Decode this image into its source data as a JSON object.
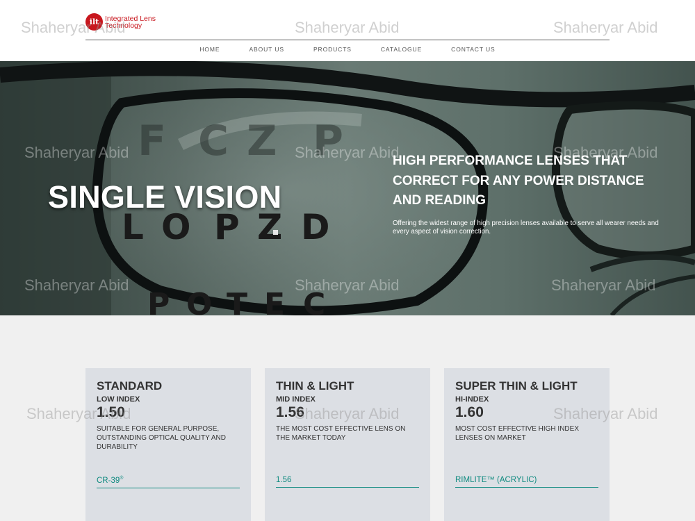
{
  "brand": {
    "logo_mark": "ilt",
    "line1": "Integrated Lens",
    "line2": "Technology",
    "color": "#c8171e"
  },
  "nav": [
    "HOME",
    "ABOUT US",
    "PRODUCTS",
    "CATALOGUE",
    "CONTACT US"
  ],
  "hero": {
    "title": "SINGLE VISION",
    "heading": "HIGH PERFORMANCE LENSES THAT CORRECT FOR ANY POWER DISTANCE AND READING",
    "text": "Offering the widest range of high precision lenses available to serve all wearer needs and every aspect of vision correction.",
    "eye_chart": {
      "row1": [
        "F",
        "C",
        "Z",
        "P"
      ],
      "row2": [
        "L",
        "O",
        "P",
        "Z",
        "D"
      ],
      "row3": [
        "P",
        "O",
        "T",
        "E",
        "C"
      ]
    }
  },
  "cards": [
    {
      "title": "STANDARD",
      "sub": "LOW INDEX",
      "index": "1.50",
      "desc": "SUITABLE FOR GENERAL PURPOSE, OUTSTANDING OPTICAL QUALITY AND DURABILITY",
      "link": "CR-39",
      "link_sup": "®"
    },
    {
      "title": "THIN & LIGHT",
      "sub": "MID INDEX",
      "index": "1.56",
      "desc": "THE MOST COST EFFECTIVE LENS ON THE MARKET TODAY",
      "link": "1.56",
      "link_sup": ""
    },
    {
      "title": "SUPER THIN & LIGHT",
      "sub": "HI-INDEX",
      "index": "1.60",
      "desc": "MOST COST EFFECTIVE HIGH INDEX LENSES ON MARKET",
      "link": "RIMLITE™ (ACRYLIC)",
      "link_sup": ""
    }
  ],
  "watermark": "Shaheryar Abid",
  "colors": {
    "accent": "#0f8a7f",
    "card_bg": "#dcdfe4",
    "page_bg": "#f0f0f0"
  }
}
